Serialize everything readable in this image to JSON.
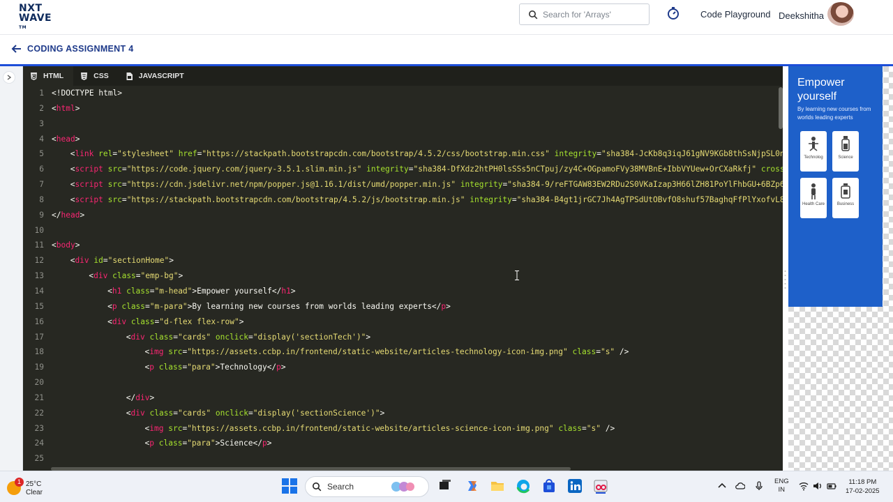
{
  "header": {
    "logo_line1": "NXT",
    "logo_line2": "WAVE",
    "logo_tm": "TM",
    "search_placeholder": "Search for 'Arrays'",
    "playground_link": "Code Playground",
    "user_name": "Deekshitha"
  },
  "assignment": {
    "title": "CODING ASSIGNMENT 4"
  },
  "editor": {
    "tabs": [
      {
        "label": "HTML",
        "active": true
      },
      {
        "label": "CSS",
        "active": false
      },
      {
        "label": "JAVASCRIPT",
        "active": false
      }
    ],
    "lines": [
      {
        "n": "1",
        "indent": 0,
        "segs": [
          [
            "p",
            "<!DOCTYPE html>"
          ]
        ]
      },
      {
        "n": "2",
        "indent": 0,
        "segs": [
          [
            "p",
            "<"
          ],
          [
            "t",
            "html"
          ],
          [
            "p",
            ">"
          ]
        ]
      },
      {
        "n": "3",
        "indent": 0,
        "segs": []
      },
      {
        "n": "4",
        "indent": 0,
        "segs": [
          [
            "p",
            "<"
          ],
          [
            "t",
            "head"
          ],
          [
            "p",
            ">"
          ]
        ]
      },
      {
        "n": "5",
        "indent": 1,
        "segs": [
          [
            "p",
            "<"
          ],
          [
            "t",
            "link"
          ],
          [
            "p",
            " "
          ],
          [
            "a",
            "rel"
          ],
          [
            "p",
            "="
          ],
          [
            "s",
            "\"stylesheet\""
          ],
          [
            "p",
            " "
          ],
          [
            "a",
            "href"
          ],
          [
            "p",
            "="
          ],
          [
            "s",
            "\"https://stackpath.bootstrapcdn.com/bootstrap/4.5.2/css/bootstrap.min.css\""
          ],
          [
            "p",
            " "
          ],
          [
            "a",
            "integrity"
          ],
          [
            "p",
            "="
          ],
          [
            "s",
            "\"sha384-JcKb8q3iqJ61gNV9KGb8thSsNjpSL0n"
          ]
        ]
      },
      {
        "n": "6",
        "indent": 1,
        "segs": [
          [
            "p",
            "<"
          ],
          [
            "t",
            "script"
          ],
          [
            "p",
            " "
          ],
          [
            "a",
            "src"
          ],
          [
            "p",
            "="
          ],
          [
            "s",
            "\"https://code.jquery.com/jquery-3.5.1.slim.min.js\""
          ],
          [
            "p",
            " "
          ],
          [
            "a",
            "integrity"
          ],
          [
            "p",
            "="
          ],
          [
            "s",
            "\"sha384-DfXdz2htPH0lsSSs5nCTpuj/zy4C+OGpamoFVy38MVBnE+IbbVYUew+OrCXaRkfj\""
          ],
          [
            "p",
            " "
          ],
          [
            "a",
            "cross"
          ]
        ]
      },
      {
        "n": "7",
        "indent": 1,
        "segs": [
          [
            "p",
            "<"
          ],
          [
            "t",
            "script"
          ],
          [
            "p",
            " "
          ],
          [
            "a",
            "src"
          ],
          [
            "p",
            "="
          ],
          [
            "s",
            "\"https://cdn.jsdelivr.net/npm/popper.js@1.16.1/dist/umd/popper.min.js\""
          ],
          [
            "p",
            " "
          ],
          [
            "a",
            "integrity"
          ],
          [
            "p",
            "="
          ],
          [
            "s",
            "\"sha384-9/reFTGAW83EW2RDu2S0VKaIzap3H66lZH81PoYlFhbGU+6BZp6"
          ]
        ]
      },
      {
        "n": "8",
        "indent": 1,
        "segs": [
          [
            "p",
            "<"
          ],
          [
            "t",
            "script"
          ],
          [
            "p",
            " "
          ],
          [
            "a",
            "src"
          ],
          [
            "p",
            "="
          ],
          [
            "s",
            "\"https://stackpath.bootstrapcdn.com/bootstrap/4.5.2/js/bootstrap.min.js\""
          ],
          [
            "p",
            " "
          ],
          [
            "a",
            "integrity"
          ],
          [
            "p",
            "="
          ],
          [
            "s",
            "\"sha384-B4gt1jrGC7Jh4AgTPSdUtOBvfO8shuf57BaghqFfPlYxofvL8"
          ]
        ]
      },
      {
        "n": "9",
        "indent": 0,
        "segs": [
          [
            "p",
            "</"
          ],
          [
            "t",
            "head"
          ],
          [
            "p",
            ">"
          ]
        ]
      },
      {
        "n": "10",
        "indent": 0,
        "segs": []
      },
      {
        "n": "11",
        "indent": 0,
        "segs": [
          [
            "p",
            "<"
          ],
          [
            "t",
            "body"
          ],
          [
            "p",
            ">"
          ]
        ]
      },
      {
        "n": "12",
        "indent": 1,
        "segs": [
          [
            "p",
            "<"
          ],
          [
            "t",
            "div"
          ],
          [
            "p",
            " "
          ],
          [
            "a",
            "id"
          ],
          [
            "p",
            "="
          ],
          [
            "s",
            "\"sectionHome\""
          ],
          [
            "p",
            ">"
          ]
        ]
      },
      {
        "n": "13",
        "indent": 2,
        "segs": [
          [
            "p",
            "<"
          ],
          [
            "t",
            "div"
          ],
          [
            "p",
            " "
          ],
          [
            "a",
            "class"
          ],
          [
            "p",
            "="
          ],
          [
            "s",
            "\"emp-bg\""
          ],
          [
            "p",
            ">"
          ]
        ]
      },
      {
        "n": "14",
        "indent": 3,
        "segs": [
          [
            "p",
            "<"
          ],
          [
            "t",
            "h1"
          ],
          [
            "p",
            " "
          ],
          [
            "a",
            "class"
          ],
          [
            "p",
            "="
          ],
          [
            "s",
            "\"m-head\""
          ],
          [
            "p",
            ">Empower yourself</"
          ],
          [
            "t",
            "h1"
          ],
          [
            "p",
            ">"
          ]
        ]
      },
      {
        "n": "15",
        "indent": 3,
        "segs": [
          [
            "p",
            "<"
          ],
          [
            "t",
            "p"
          ],
          [
            "p",
            " "
          ],
          [
            "a",
            "class"
          ],
          [
            "p",
            "="
          ],
          [
            "s",
            "\"m-para\""
          ],
          [
            "p",
            ">By learning new courses from worlds leading experts</"
          ],
          [
            "t",
            "p"
          ],
          [
            "p",
            ">"
          ]
        ]
      },
      {
        "n": "16",
        "indent": 3,
        "segs": [
          [
            "p",
            "<"
          ],
          [
            "t",
            "div"
          ],
          [
            "p",
            " "
          ],
          [
            "a",
            "class"
          ],
          [
            "p",
            "="
          ],
          [
            "s",
            "\"d-flex flex-row\""
          ],
          [
            "p",
            ">"
          ]
        ]
      },
      {
        "n": "17",
        "indent": 4,
        "segs": [
          [
            "p",
            "<"
          ],
          [
            "t",
            "div"
          ],
          [
            "p",
            " "
          ],
          [
            "a",
            "class"
          ],
          [
            "p",
            "="
          ],
          [
            "s",
            "\"cards\""
          ],
          [
            "p",
            " "
          ],
          [
            "a",
            "onclick"
          ],
          [
            "p",
            "="
          ],
          [
            "s",
            "\"display('sectionTech')\""
          ],
          [
            "p",
            ">"
          ]
        ]
      },
      {
        "n": "18",
        "indent": 5,
        "segs": [
          [
            "p",
            "<"
          ],
          [
            "t",
            "img"
          ],
          [
            "p",
            " "
          ],
          [
            "a",
            "src"
          ],
          [
            "p",
            "="
          ],
          [
            "s",
            "\"https://assets.ccbp.in/frontend/static-website/articles-technology-icon-img.png\""
          ],
          [
            "p",
            " "
          ],
          [
            "a",
            "class"
          ],
          [
            "p",
            "="
          ],
          [
            "s",
            "\"s\""
          ],
          [
            "p",
            " />"
          ]
        ]
      },
      {
        "n": "19",
        "indent": 5,
        "segs": [
          [
            "p",
            "<"
          ],
          [
            "t",
            "p"
          ],
          [
            "p",
            " "
          ],
          [
            "a",
            "class"
          ],
          [
            "p",
            "="
          ],
          [
            "s",
            "\"para\""
          ],
          [
            "p",
            ">Technology</"
          ],
          [
            "t",
            "p"
          ],
          [
            "p",
            ">"
          ]
        ]
      },
      {
        "n": "20",
        "indent": 0,
        "segs": []
      },
      {
        "n": "21",
        "indent": 4,
        "segs": [
          [
            "p",
            "</"
          ],
          [
            "t",
            "div"
          ],
          [
            "p",
            ">"
          ]
        ]
      },
      {
        "n": "22",
        "indent": 4,
        "segs": [
          [
            "p",
            "<"
          ],
          [
            "t",
            "div"
          ],
          [
            "p",
            " "
          ],
          [
            "a",
            "class"
          ],
          [
            "p",
            "="
          ],
          [
            "s",
            "\"cards\""
          ],
          [
            "p",
            " "
          ],
          [
            "a",
            "onclick"
          ],
          [
            "p",
            "="
          ],
          [
            "s",
            "\"display('sectionScience')\""
          ],
          [
            "p",
            ">"
          ]
        ]
      },
      {
        "n": "23",
        "indent": 5,
        "segs": [
          [
            "p",
            "<"
          ],
          [
            "t",
            "img"
          ],
          [
            "p",
            " "
          ],
          [
            "a",
            "src"
          ],
          [
            "p",
            "="
          ],
          [
            "s",
            "\"https://assets.ccbp.in/frontend/static-website/articles-science-icon-img.png\""
          ],
          [
            "p",
            " "
          ],
          [
            "a",
            "class"
          ],
          [
            "p",
            "="
          ],
          [
            "s",
            "\"s\""
          ],
          [
            "p",
            " />"
          ]
        ]
      },
      {
        "n": "24",
        "indent": 5,
        "segs": [
          [
            "p",
            "<"
          ],
          [
            "t",
            "p"
          ],
          [
            "p",
            " "
          ],
          [
            "a",
            "class"
          ],
          [
            "p",
            "="
          ],
          [
            "s",
            "\"para\""
          ],
          [
            "p",
            ">Science</"
          ],
          [
            "t",
            "p"
          ],
          [
            "p",
            ">"
          ]
        ]
      },
      {
        "n": "25",
        "indent": 0,
        "segs": []
      }
    ]
  },
  "preview": {
    "heading": "Empower yourself",
    "para": "By learning new courses from worlds leading experts",
    "cards": [
      {
        "label": "Technolog",
        "icon": "technology-icon"
      },
      {
        "label": "Science",
        "icon": "science-icon"
      },
      {
        "label": "Health Care",
        "icon": "health-care-icon"
      },
      {
        "label": "Business",
        "icon": "business-icon"
      }
    ]
  },
  "taskbar": {
    "weather_temp": "25°C",
    "weather_desc": "Clear",
    "weather_badge": "1",
    "search_label": "Search",
    "lang_line1": "ENG",
    "lang_line2": "IN",
    "time": "11:18 PM",
    "date": "17-02-2025"
  },
  "colors": {
    "brand_blue": "#1e3a8a",
    "accent_line": "#1d4ed8",
    "editor_bg": "#272822",
    "tag": "#f92672",
    "attr": "#a6e22e",
    "string": "#e6db74",
    "preview_bg": "#1e60c9"
  }
}
